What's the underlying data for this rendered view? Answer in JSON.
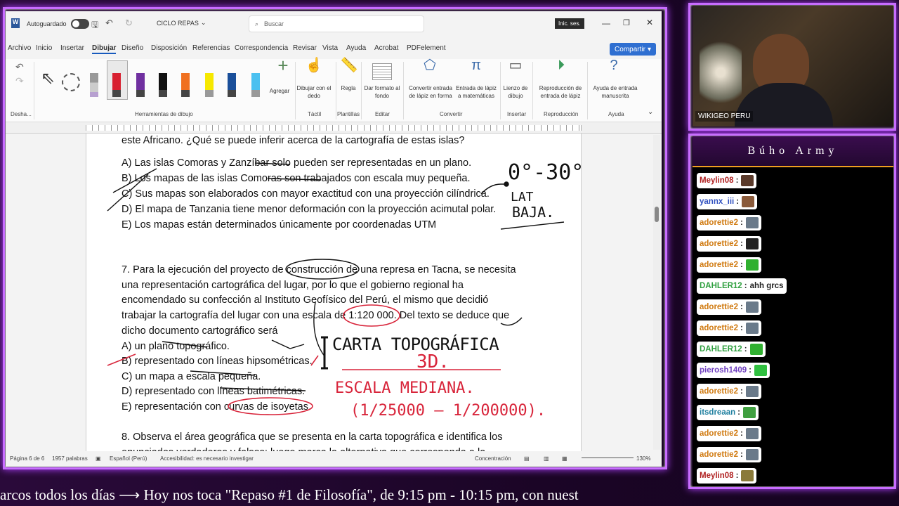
{
  "word": {
    "autosave_label": "Autoguardado",
    "doc_name": "CICLO REPAS",
    "search_placeholder": "Buscar",
    "signin_label": "Inic. ses.",
    "menu": [
      "Archivo",
      "Inicio",
      "Insertar",
      "Dibujar",
      "Diseño",
      "Disposición",
      "Referencias",
      "Correspondencia",
      "Revisar",
      "Vista",
      "Ayuda",
      "Acrobat",
      "PDFelement"
    ],
    "share_label": "Compartir",
    "ribbon": {
      "add_label": "Agregar",
      "draw_finger": "Dibujar con el dedo",
      "ruler_label": "Regla",
      "format_bg": "Dar formato al fondo",
      "ink_to_shape": "Convertir entrada de lápiz en forma",
      "ink_to_math": "Entrada de lápiz a matemáticas",
      "canvas": "Lienzo de dibujo",
      "replay": "Reproducción de entrada de lápiz",
      "help_ink": "Ayuda de entrada manuscrita",
      "groups": [
        "Desha...",
        "Herramientas de dibujo",
        "Táctil",
        "Plantillas",
        "Editar",
        "Convertir",
        "Insertar",
        "Reproducción",
        "Ayuda"
      ]
    },
    "document": {
      "lines_q6": [
        "este Africano. ¿Qué se puede inferir acerca de la cartografía de estas islas?",
        "A) Las islas Comoras y Zanzíbar solo pueden ser representadas en un plano.",
        "B) Los mapas de las islas Comoras son trabajados con escala muy pequeña.",
        "C) Sus mapas son elaborados con mayor exactitud con una proyección cilíndrica.",
        "D) El mapa de Tanzania tiene menor deformación con la proyección acimutal polar.",
        "E) Los mapas están determinados únicamente por coordenadas UTM"
      ],
      "lines_q7": [
        "7. Para la ejecución del proyecto de construcción de una represa en Tacna, se necesita",
        "una representación cartográfica del lugar, por lo que el gobierno regional ha",
        "encomendado su confección al Instituto Geofísico del Perú, el mismo que decidió",
        "trabajar la cartografía del lugar con una escala de 1:120 000. Del texto se deduce que",
        "dicho documento cartográfico será",
        "A) un plano topográfico.",
        "B) representado con líneas hipsométricas.",
        "C) un mapa a escala pequeña.",
        "D) representado con líneas batimétricas.",
        "E) representación con curvas de isoyetas."
      ],
      "lines_q8": [
        "8. Observa el área geográfica que se presenta en la carta topográfica e identifica los",
        "enunciados verdaderos y falsos; luego marca la alternativa que corresponda a la"
      ],
      "ink": {
        "lat_range": "0°-30°",
        "lat": "LAT",
        "baja": "BAJA.",
        "carta": "CARTA TOPOGRÁFICA",
        "three_d": "3D.",
        "escala": "ESCALA MEDIANA.",
        "range": "(1/25000 – 1/200000)."
      }
    },
    "status": {
      "page": "Página 6 de 6",
      "words": "1957 palabras",
      "language": "Español (Perú)",
      "accessibility": "Accesibilidad: es necesario investigar",
      "focus": "Concentración",
      "zoom": "130%"
    }
  },
  "stream": {
    "cam_label": "WIKIGEO PERU",
    "chat_title": "Búho Army",
    "messages": [
      {
        "user": "Meylin08",
        "text": "",
        "color": "#b02020",
        "emote": "#5a3a2a"
      },
      {
        "user": "yannx_iii",
        "text": "",
        "color": "#3050c0",
        "emote": "#8a5a3a"
      },
      {
        "user": "adorettie2",
        "text": "",
        "color": "#d07a10",
        "emote": "#6a7a8a"
      },
      {
        "user": "adorettie2",
        "text": "",
        "color": "#d07a10",
        "emote": "#222222"
      },
      {
        "user": "adorettie2",
        "text": "",
        "color": "#d07a10",
        "emote": "#30b030"
      },
      {
        "user": "DAHLER12",
        "text": "ahh grcs",
        "color": "#30a040",
        "emote": ""
      },
      {
        "user": "adorettie2",
        "text": "",
        "color": "#d07a10",
        "emote": "#6a7a8a"
      },
      {
        "user": "adorettie2",
        "text": "",
        "color": "#d07a10",
        "emote": "#6a7a8a"
      },
      {
        "user": "DAHLER12",
        "text": "",
        "color": "#30a040",
        "emote": "#30b030"
      },
      {
        "user": "pierosh1409",
        "text": "",
        "color": "#7040c0",
        "emote": "#30c040"
      },
      {
        "user": "adorettie2",
        "text": "",
        "color": "#d07a10",
        "emote": "#6a7a8a"
      },
      {
        "user": "itsdreaan",
        "text": "",
        "color": "#2080a0",
        "emote": "#40a040"
      },
      {
        "user": "adorettie2",
        "text": "",
        "color": "#d07a10",
        "emote": "#6a7a8a"
      },
      {
        "user": "adorettie2",
        "text": "",
        "color": "#d07a10",
        "emote": "#6a7a8a"
      },
      {
        "user": "Meylin08",
        "text": "",
        "color": "#b02020",
        "emote": "#8a7a3a"
      }
    ],
    "ticker": "arcos todos los días  ⟶  Hoy nos toca \"Repaso #1 de Filosofía\", de 9:15 pm - 10:15 pm, con nuest"
  },
  "colors": {
    "accent": "#c86dff",
    "ink_black": "#111111",
    "ink_red": "#d8243a",
    "word_blue": "#185abd"
  }
}
